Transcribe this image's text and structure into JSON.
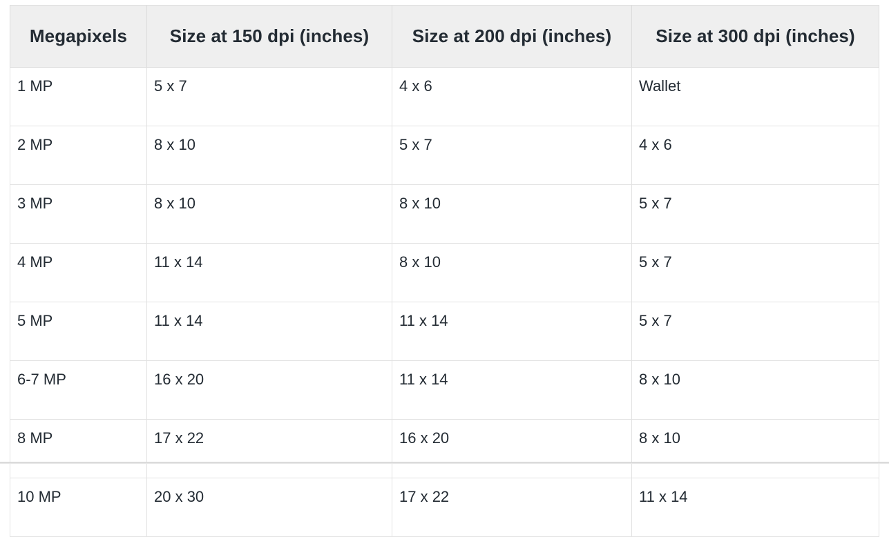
{
  "table": {
    "caption": "",
    "columns": [
      "Megapixels",
      "Size at 150 dpi (inches)",
      "Size at 200 dpi (inches)",
      "Size at 300 dpi (inches)"
    ],
    "rows": [
      {
        "megapixels": "1 MP",
        "dpi150": "5 x 7",
        "dpi200": "4 x 6",
        "dpi300": "Wallet"
      },
      {
        "megapixels": "2 MP",
        "dpi150": "8 x 10",
        "dpi200": "5 x 7",
        "dpi300": "4 x 6"
      },
      {
        "megapixels": "3 MP",
        "dpi150": "8 x 10",
        "dpi200": "8 x 10",
        "dpi300": "5 x 7"
      },
      {
        "megapixels": "4 MP",
        "dpi150": "11 x 14",
        "dpi200": "8 x 10",
        "dpi300": "5 x 7"
      },
      {
        "megapixels": "5 MP",
        "dpi150": "11 x 14",
        "dpi200": "11 x 14",
        "dpi300": "5 x 7"
      },
      {
        "megapixels": "6-7 MP",
        "dpi150": "16 x 20",
        "dpi200": "11 x 14",
        "dpi300": "8 x 10"
      },
      {
        "megapixels": "8 MP",
        "dpi150": "17 x 22",
        "dpi200": "16 x 20",
        "dpi300": "8 x 10"
      },
      {
        "megapixels": "10 MP",
        "dpi150": "20 x 30",
        "dpi200": "17 x 22",
        "dpi300": "11 x 14"
      }
    ]
  },
  "colors": {
    "header_background": "#efefef",
    "text": "#232b33",
    "border": "#e2e2e2",
    "page_rule": "#c8c8c8"
  }
}
